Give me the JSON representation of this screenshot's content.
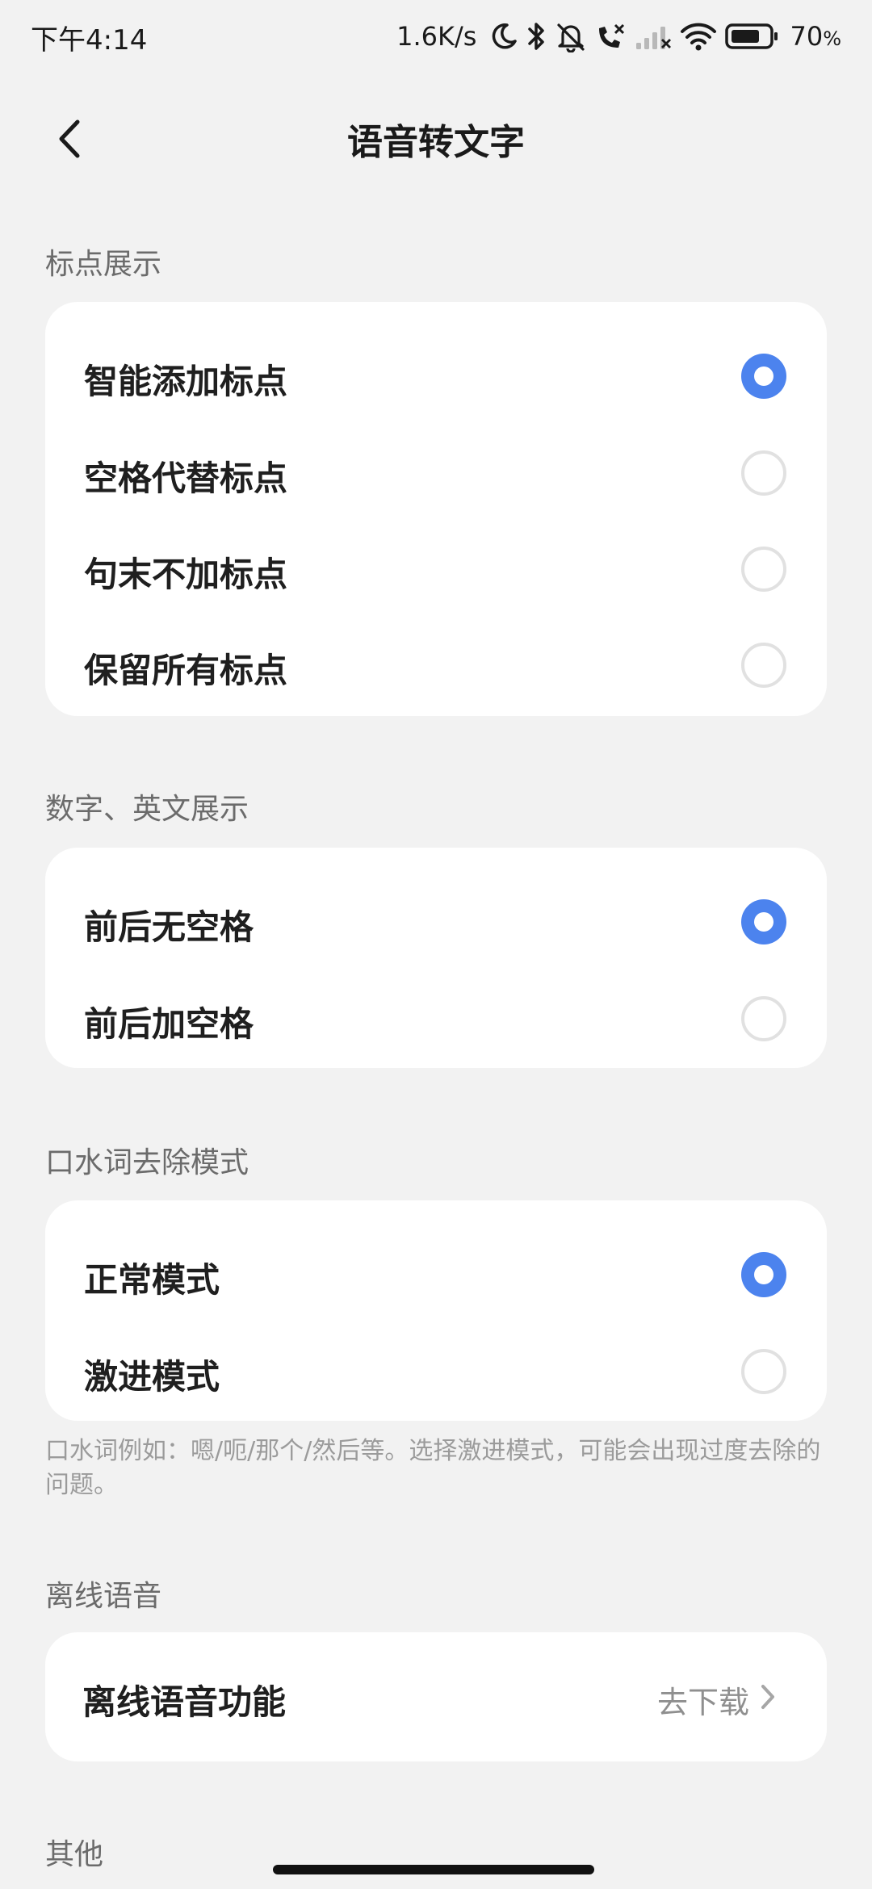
{
  "status_bar": {
    "time": "下午4:14",
    "net_speed": "1.6K/s",
    "battery_level": "70",
    "battery_unit": "%",
    "icons": [
      "moon-icon",
      "bluetooth-icon",
      "mute-bell-icon",
      "missed-call-icon",
      "signal-icon",
      "wifi-icon",
      "battery-icon"
    ]
  },
  "header": {
    "title": "语音转文字"
  },
  "sections": {
    "punctuation": {
      "title": "标点展示",
      "options": [
        {
          "label": "智能添加标点",
          "selected": true
        },
        {
          "label": "空格代替标点",
          "selected": false
        },
        {
          "label": "句末不加标点",
          "selected": false
        },
        {
          "label": "保留所有标点",
          "selected": false
        }
      ]
    },
    "numbers_english": {
      "title": "数字、英文展示",
      "options": [
        {
          "label": "前后无空格",
          "selected": true
        },
        {
          "label": "前后加空格",
          "selected": false
        }
      ]
    },
    "filler_words": {
      "title": "口水词去除模式",
      "options": [
        {
          "label": "正常模式",
          "selected": true
        },
        {
          "label": "激进模式",
          "selected": false
        }
      ],
      "hint": "口水词例如：嗯/呃/那个/然后等。选择激进模式，可能会出现过度去除的问题。"
    },
    "offline": {
      "title": "离线语音",
      "item_label": "离线语音功能",
      "item_value": "去下载"
    },
    "other": {
      "title": "其他"
    }
  },
  "colors": {
    "accent": "#4c83ee",
    "background": "#f2f2f2",
    "card": "#ffffff"
  }
}
